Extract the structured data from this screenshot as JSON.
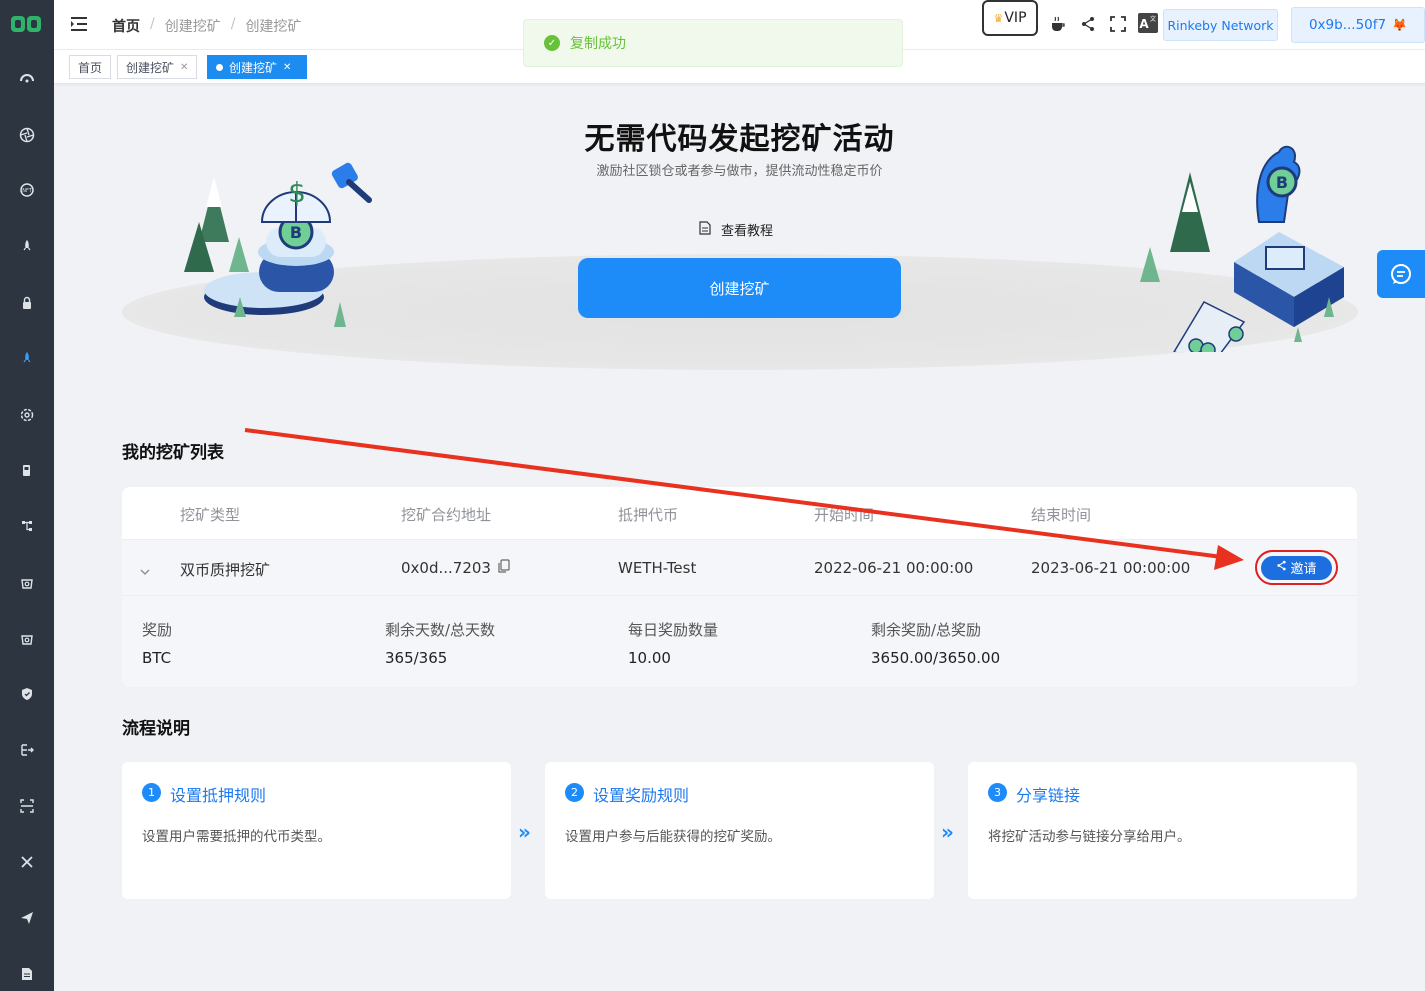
{
  "sidebar": {
    "icons": [
      "logo-icon",
      "dashboard-icon",
      "aperture-icon",
      "badge-icon",
      "rocket-icon",
      "lock-icon",
      "mining-icon",
      "settings-icon",
      "fuel-icon",
      "tree-icon",
      "bag-icon",
      "bag2-icon",
      "shield-icon",
      "export-icon",
      "scan-icon",
      "tools-icon",
      "send-icon",
      "document-icon"
    ]
  },
  "header": {
    "breadcrumb": [
      "首页",
      "创建挖矿",
      "创建挖矿"
    ],
    "vip_label": "VIP",
    "network_label": "Rinkeby Network",
    "wallet_label": "0x9b...50f7"
  },
  "tags": [
    {
      "label": "首页"
    },
    {
      "label": "创建挖矿"
    },
    {
      "label": "创建挖矿"
    }
  ],
  "toast": {
    "message": "复制成功"
  },
  "hero": {
    "title": "无需代码发起挖矿活动",
    "subtitle": "激励社区锁仓或者参与做市，提供流动性稳定币价",
    "tutorial_label": "查看教程",
    "create_label": "创建挖矿"
  },
  "list": {
    "title": "我的挖矿列表",
    "columns": [
      "挖矿类型",
      "挖矿合约地址",
      "抵押代币",
      "开始时间",
      "结束时间"
    ],
    "row": {
      "type": "双币质押挖矿",
      "address": "0x0d...7203",
      "token": "WETH-Test",
      "start": "2022-06-21 00:00:00",
      "end": "2023-06-21 00:00:00",
      "invite_label": "邀请"
    },
    "details": [
      {
        "label": "奖励",
        "value": "BTC"
      },
      {
        "label": "剩余天数/总天数",
        "value": "365/365"
      },
      {
        "label": "每日奖励数量",
        "value": "10.00"
      },
      {
        "label": "剩余奖励/总奖励",
        "value": "3650.00/3650.00"
      }
    ]
  },
  "process": {
    "title": "流程说明",
    "steps": [
      {
        "num": "1",
        "title": "设置抵押规则",
        "desc": "设置用户需要抵押的代币类型。"
      },
      {
        "num": "2",
        "title": "设置奖励规则",
        "desc": "设置用户参与后能获得的挖矿奖励。"
      },
      {
        "num": "3",
        "title": "分享链接",
        "desc": "将挖矿活动参与链接分享给用户。"
      }
    ],
    "arrow": "»"
  },
  "colors": {
    "accent": "#1d8cf8",
    "sidebar": "#2c3540",
    "annotation": "#e02020",
    "success": "#67c23a"
  }
}
